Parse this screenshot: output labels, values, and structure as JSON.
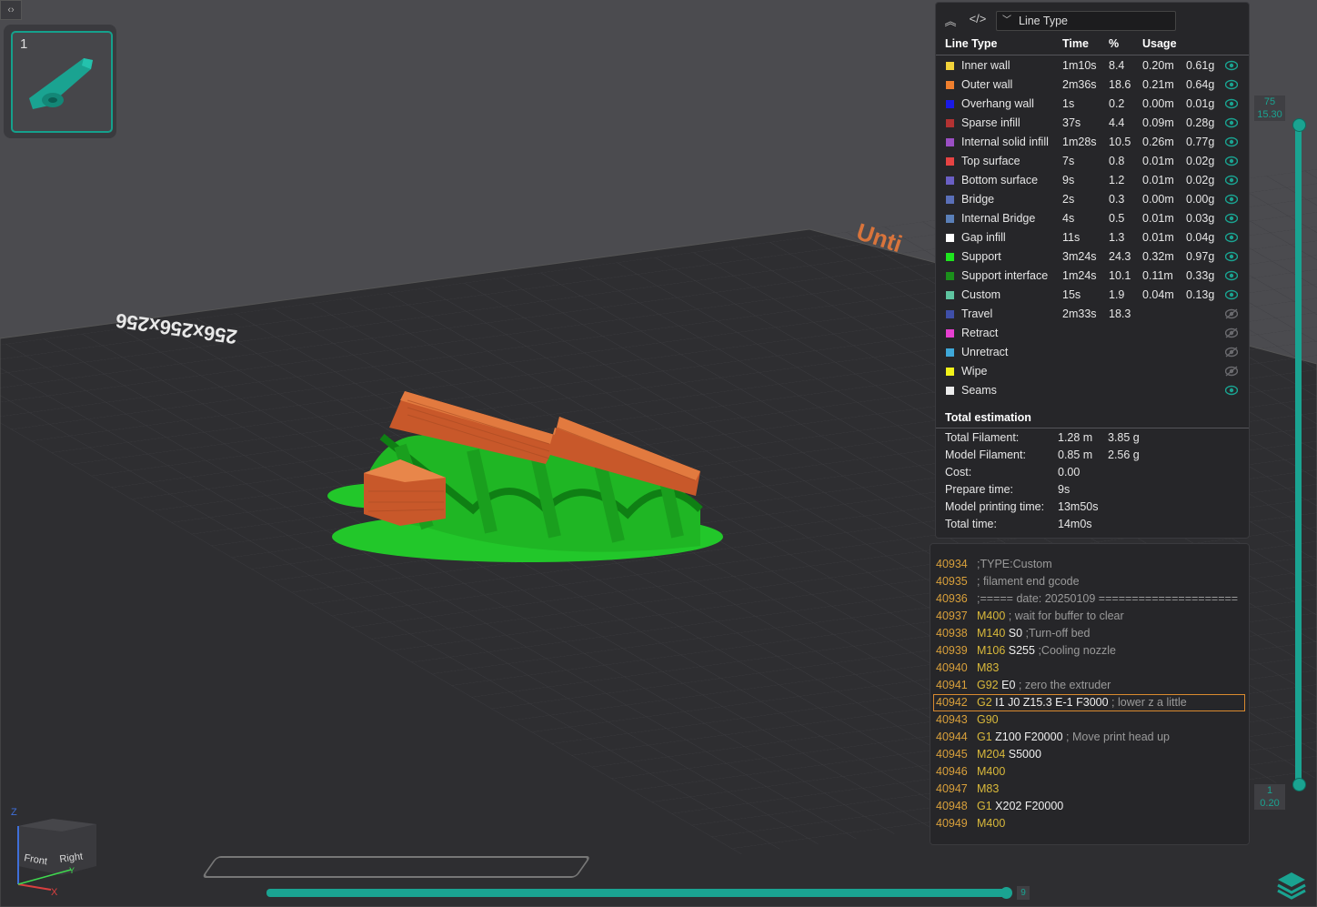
{
  "plate": {
    "number": "1"
  },
  "bed_label": "256x256x256",
  "bed_label_orange": "Unti",
  "legend": {
    "dropdown_value": "Line Type",
    "headers": {
      "line_type": "Line Type",
      "time": "Time",
      "percent": "%",
      "usage": "Usage"
    },
    "rows": [
      {
        "name": "Inner wall",
        "time": "1m10s",
        "percent": "8.4",
        "length": "0.20m",
        "weight": "0.61g",
        "color": "#f2d23a",
        "visible": true
      },
      {
        "name": "Outer wall",
        "time": "2m36s",
        "percent": "18.6",
        "length": "0.21m",
        "weight": "0.64g",
        "color": "#f07f2e",
        "visible": true
      },
      {
        "name": "Overhang wall",
        "time": "1s",
        "percent": "0.2",
        "length": "0.00m",
        "weight": "0.01g",
        "color": "#1a1ae6",
        "visible": true
      },
      {
        "name": "Sparse infill",
        "time": "37s",
        "percent": "4.4",
        "length": "0.09m",
        "weight": "0.28g",
        "color": "#b33232",
        "visible": true
      },
      {
        "name": "Internal solid infill",
        "time": "1m28s",
        "percent": "10.5",
        "length": "0.26m",
        "weight": "0.77g",
        "color": "#9b4fc4",
        "visible": true
      },
      {
        "name": "Top surface",
        "time": "7s",
        "percent": "0.8",
        "length": "0.01m",
        "weight": "0.02g",
        "color": "#e64343",
        "visible": true
      },
      {
        "name": "Bottom surface",
        "time": "9s",
        "percent": "1.2",
        "length": "0.01m",
        "weight": "0.02g",
        "color": "#6a5fc4",
        "visible": true
      },
      {
        "name": "Bridge",
        "time": "2s",
        "percent": "0.3",
        "length": "0.00m",
        "weight": "0.00g",
        "color": "#5a6fb8",
        "visible": true
      },
      {
        "name": "Internal Bridge",
        "time": "4s",
        "percent": "0.5",
        "length": "0.01m",
        "weight": "0.03g",
        "color": "#5a7fb8",
        "visible": true
      },
      {
        "name": "Gap infill",
        "time": "11s",
        "percent": "1.3",
        "length": "0.01m",
        "weight": "0.04g",
        "color": "#ffffff",
        "visible": true
      },
      {
        "name": "Support",
        "time": "3m24s",
        "percent": "24.3",
        "length": "0.32m",
        "weight": "0.97g",
        "color": "#1ee61e",
        "visible": true
      },
      {
        "name": "Support interface",
        "time": "1m24s",
        "percent": "10.1",
        "length": "0.11m",
        "weight": "0.33g",
        "color": "#1b8f1b",
        "visible": true
      },
      {
        "name": "Custom",
        "time": "15s",
        "percent": "1.9",
        "length": "0.04m",
        "weight": "0.13g",
        "color": "#5ec4a0",
        "visible": true
      },
      {
        "name": "Travel",
        "time": "2m33s",
        "percent": "18.3",
        "length": "",
        "weight": "",
        "color": "#3f4fa8",
        "visible": false
      },
      {
        "name": "Retract",
        "time": "",
        "percent": "",
        "length": "",
        "weight": "",
        "color": "#e63fd0",
        "visible": false
      },
      {
        "name": "Unretract",
        "time": "",
        "percent": "",
        "length": "",
        "weight": "",
        "color": "#3fa8d9",
        "visible": false
      },
      {
        "name": "Wipe",
        "time": "",
        "percent": "",
        "length": "",
        "weight": "",
        "color": "#f2f21a",
        "visible": false
      },
      {
        "name": "Seams",
        "time": "",
        "percent": "",
        "length": "",
        "weight": "",
        "color": "#ececec",
        "visible": true
      }
    ],
    "total_title": "Total estimation",
    "totals": [
      {
        "key": "Total Filament:",
        "v1": "1.28 m",
        "v2": "3.85 g"
      },
      {
        "key": "Model Filament:",
        "v1": "0.85 m",
        "v2": "2.56 g"
      },
      {
        "key": "Cost:",
        "v1": "0.00",
        "v2": ""
      },
      {
        "key": "Prepare time:",
        "v1": "9s",
        "v2": ""
      },
      {
        "key": "Model printing time:",
        "v1": "13m50s",
        "v2": ""
      },
      {
        "key": "Total time:",
        "v1": "14m0s",
        "v2": ""
      }
    ]
  },
  "gcode": [
    {
      "num": "40934",
      "cmd": "",
      "params": "",
      "comment": ";TYPE:Custom",
      "highlight": false
    },
    {
      "num": "40935",
      "cmd": "",
      "params": "",
      "comment": "; filament end gcode",
      "highlight": false
    },
    {
      "num": "40936",
      "cmd": "",
      "params": "",
      "comment": ";===== date: 20250109 =====================",
      "highlight": false
    },
    {
      "num": "40937",
      "cmd": "M400",
      "params": "",
      "comment": "; wait for buffer to clear",
      "highlight": false
    },
    {
      "num": "40938",
      "cmd": "M140",
      "params": "S0",
      "comment": ";Turn-off bed",
      "highlight": false
    },
    {
      "num": "40939",
      "cmd": "M106",
      "params": "S255",
      "comment": ";Cooling nozzle",
      "highlight": false
    },
    {
      "num": "40940",
      "cmd": "M83",
      "params": "",
      "comment": "",
      "highlight": false
    },
    {
      "num": "40941",
      "cmd": "G92",
      "params": "E0",
      "comment": "; zero the extruder",
      "highlight": false
    },
    {
      "num": "40942",
      "cmd": "G2",
      "params": "I1 J0 Z15.3 E-1 F3000",
      "comment": "; lower z a little",
      "highlight": true
    },
    {
      "num": "40943",
      "cmd": "G90",
      "params": "",
      "comment": "",
      "highlight": false
    },
    {
      "num": "40944",
      "cmd": "G1",
      "params": "Z100 F20000",
      "comment": "; Move print head up",
      "highlight": false
    },
    {
      "num": "40945",
      "cmd": "M204",
      "params": "S5000",
      "comment": "",
      "highlight": false
    },
    {
      "num": "40946",
      "cmd": "M400",
      "params": "",
      "comment": "",
      "highlight": false
    },
    {
      "num": "40947",
      "cmd": "M83",
      "params": "",
      "comment": "",
      "highlight": false
    },
    {
      "num": "40948",
      "cmd": "G1",
      "params": "X202 F20000",
      "comment": "",
      "highlight": false
    },
    {
      "num": "40949",
      "cmd": "M400",
      "params": "",
      "comment": "",
      "highlight": false
    }
  ],
  "layer_slider": {
    "top_layer": "75",
    "top_height": "15.30",
    "bottom_layer": "1",
    "bottom_height": "0.20"
  },
  "move_slider": {
    "value": "9"
  },
  "view_cube": {
    "front": "Front",
    "right": "Right",
    "axis_z": "Z",
    "axis_x": "X",
    "axis_y": "Y"
  },
  "colors": {
    "accent": "#1aa391",
    "support": "#1ee61e",
    "outer_wall": "#c8582a"
  }
}
